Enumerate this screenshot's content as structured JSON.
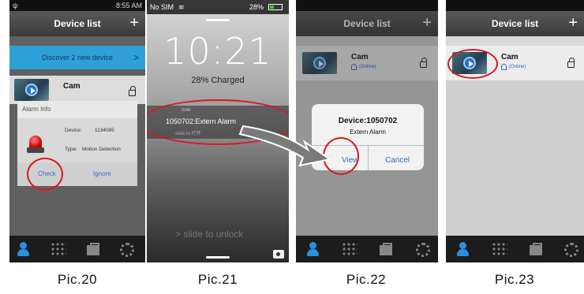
{
  "captions": [
    "Pic.20",
    "Pic.21",
    "Pic.22",
    "Pic.23"
  ],
  "pic20": {
    "status_time": "8:55 AM",
    "title": "Device list",
    "add": "+",
    "discover": "Discover  2  new device",
    "discover_arrow": ">",
    "device_name": "Cam",
    "dialog_title": "Alarm Info",
    "device_label": "Device:",
    "device_value": "1134085",
    "type_label": "Type:",
    "type_value": "Motion Detection",
    "check": "Check",
    "ignore": "Ignore"
  },
  "pic21": {
    "carrier": "No SIM",
    "battery": "28%",
    "clock": "10:21",
    "charged": "28% Charged",
    "now": "now",
    "message": "1050702:Extern Alarm",
    "slide_open": "slide to 打开",
    "unlock": "> slide to unlock"
  },
  "pic22": {
    "title": "Device list",
    "add": "+",
    "device_name": "Cam",
    "online": "(Online)",
    "alert_title": "Device:1050702",
    "alert_msg": "Extern Alarm",
    "view": "View",
    "cancel": "Cancel"
  },
  "pic23": {
    "title": "Device list",
    "add": "+",
    "device_name": "Cam",
    "online": "(Online)"
  },
  "colors": {
    "highlight_ring": "#d71920",
    "accent_blue": "#2a6fc4",
    "discover_bar": "#2f9fd8"
  }
}
